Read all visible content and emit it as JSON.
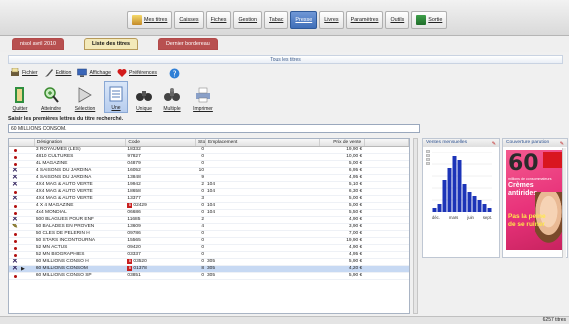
{
  "menu": [
    {
      "icon": "magazine-icon",
      "label": "Mes titres",
      "active": false
    },
    {
      "icon": "",
      "label": "Caisses",
      "active": false
    },
    {
      "icon": "",
      "label": "Fiches",
      "active": false
    },
    {
      "icon": "",
      "label": "Gestion",
      "active": false
    },
    {
      "icon": "",
      "label": "Tabac",
      "active": false
    },
    {
      "icon": "",
      "label": "Presse",
      "active": true
    },
    {
      "icon": "",
      "label": "Livres",
      "active": false
    },
    {
      "icon": "",
      "label": "Paramètres",
      "active": false
    },
    {
      "icon": "",
      "label": "Outils",
      "active": false
    },
    {
      "icon": "exit-door-icon",
      "label": "Sortie",
      "active": false
    }
  ],
  "session_tabs": [
    "nisol avril 2010",
    "Liste des titres",
    "Dernier bordereau"
  ],
  "panel_title": "Tous les titres",
  "toolbar1": [
    {
      "icon": "print-icon",
      "label": "Fichier"
    },
    {
      "icon": "pen-icon",
      "label": "Edition"
    },
    {
      "icon": "monitor-icon",
      "label": "Affichage"
    },
    {
      "icon": "heart-icon",
      "label": "Préférences"
    },
    {
      "icon": "help-icon",
      "label": ""
    }
  ],
  "toolbar2": [
    {
      "icon": "exit-icon",
      "label": "Quitter",
      "active": false
    },
    {
      "icon": "magnifier-icon",
      "label": "Atteindre",
      "active": false
    },
    {
      "icon": "arrow-icon",
      "label": "Sélection",
      "active": false
    },
    {
      "icon": "list-icon",
      "label": "Une",
      "active": true
    },
    {
      "icon": "binoculars-icon",
      "label": "Unique",
      "active": false
    },
    {
      "icon": "binoculars-multi-icon",
      "label": "Multiple",
      "active": false
    },
    {
      "icon": "printer-icon",
      "label": "Imprimer",
      "active": false
    }
  ],
  "search": {
    "label": "Saisir les premières lettres du titre recherché.",
    "value": "60 MILLIONS CONSOM."
  },
  "table": {
    "columns": [
      "",
      "Désignation",
      "Code",
      "Stock",
      "Emplacement",
      "Prix de vente",
      ""
    ],
    "rows": [
      {
        "mark": "dot",
        "name": "3 ROYAUMES (LES)",
        "code": "18332",
        "flag": "",
        "stock": "0",
        "place": "",
        "price": "19,90 €"
      },
      {
        "mark": "dot",
        "name": "4810 CULTURES",
        "code": "97827",
        "flag": "",
        "stock": "0",
        "place": "",
        "price": "10,00 €"
      },
      {
        "mark": "dot",
        "name": "4L MAGAZINE",
        "code": "04879",
        "flag": "",
        "stock": "0",
        "place": "",
        "price": "5,00 €"
      },
      {
        "mark": "cross",
        "name": "4 SAISONS DU JARDINA",
        "code": "16052",
        "flag": "",
        "stock": "10",
        "place": "",
        "price": "6,95 €"
      },
      {
        "mark": "cross",
        "name": "4 SAISONS DU JARDINA",
        "code": "13848",
        "flag": "",
        "stock": "9",
        "place": "",
        "price": "4,95 €"
      },
      {
        "mark": "cross",
        "name": "4X4 MAG & AUTO VERTE",
        "code": "19942",
        "flag": "",
        "stock": "2",
        "place": "104",
        "price": "5,10 €"
      },
      {
        "mark": "dot",
        "name": "4X4 MAG & AUTO VERTE",
        "code": "18658",
        "flag": "",
        "stock": "0",
        "place": "104",
        "price": "6,30 €"
      },
      {
        "mark": "cross",
        "name": "4X4 MAG & AUTO VERTE",
        "code": "13377",
        "flag": "",
        "stock": "3",
        "place": "",
        "price": "5,00 €"
      },
      {
        "mark": "dot",
        "name": "4 X 4 MAGAZINE",
        "code": "02429",
        "flag": "B",
        "stock": "0",
        "place": "104",
        "price": "5,00 €"
      },
      {
        "mark": "dot",
        "name": "4x4 MONDIAL",
        "code": "06686",
        "flag": "",
        "stock": "0",
        "place": "104",
        "price": "5,50 €"
      },
      {
        "mark": "cross",
        "name": "500 BLAGUES POUR ENF",
        "code": "11685",
        "flag": "",
        "stock": "2",
        "place": "",
        "price": "4,90 €"
      },
      {
        "mark": "pen",
        "name": "50 BALADES EN PROVEN",
        "code": "13609",
        "flag": "",
        "stock": "4",
        "place": "",
        "price": "3,90 €"
      },
      {
        "mark": "dot",
        "name": "50 CLES DE PELERIN H",
        "code": "09786",
        "flag": "",
        "stock": "0",
        "place": "",
        "price": "7,00 €"
      },
      {
        "mark": "dot",
        "name": "50 STARS INCONTOURNA",
        "code": "15565",
        "flag": "",
        "stock": "0",
        "place": "",
        "price": "19,90 €"
      },
      {
        "mark": "dot",
        "name": "52 MN ACTUS",
        "code": "09420",
        "flag": "",
        "stock": "0",
        "place": "",
        "price": "4,90 €"
      },
      {
        "mark": "dot",
        "name": "52 MN BIOGRAPHIES",
        "code": "03337",
        "flag": "",
        "stock": "0",
        "place": "",
        "price": "4,95 €"
      },
      {
        "mark": "cross",
        "name": "60 MILLIONS CONSO H",
        "code": "03520",
        "flag": "B",
        "stock": "0",
        "place": "305",
        "price": "5,90 €"
      },
      {
        "mark": "cross",
        "name": "60 MILLIONS CONSOM",
        "code": "01378",
        "flag": "B",
        "stock": "8",
        "place": "305",
        "price": "4,20 €",
        "selected": true
      },
      {
        "mark": "dot",
        "name": "60 MILLIONS CONSO SP",
        "code": "03851",
        "flag": "",
        "stock": "0",
        "place": "305",
        "price": "5,90 €"
      }
    ]
  },
  "sales_panel": {
    "title": "Ventes mensuelles",
    "months": [
      "déc.",
      "mars",
      "juin",
      "sept."
    ]
  },
  "cover_panel": {
    "title": "Couverture parution",
    "cover": {
      "number": "60",
      "line1": "millions de consommateurs",
      "line2": "Crèmes",
      "line3": "antirides",
      "line4": "Pas la peine",
      "line5": "de se ruiner"
    }
  },
  "status": "6257 titres",
  "chart_data": {
    "type": "bar",
    "title": "Ventes mensuelles",
    "categories": [
      "m1",
      "m2",
      "m3",
      "m4",
      "m5",
      "m6",
      "m7",
      "m8",
      "m9",
      "m10",
      "m11",
      "m12"
    ],
    "values": [
      1,
      2,
      8,
      11,
      14,
      13,
      7,
      5,
      4,
      3,
      2,
      1
    ],
    "xlabel": "",
    "ylabel": "",
    "tick_labels": [
      "déc.",
      "mars",
      "juin",
      "sept."
    ],
    "ylim": [
      0,
      15
    ],
    "grid": true
  }
}
